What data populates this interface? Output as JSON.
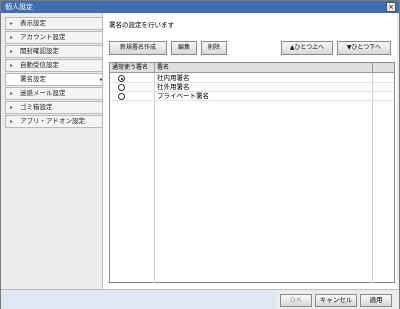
{
  "window": {
    "title": "個人設定",
    "close_label": "×"
  },
  "sidebar": {
    "items": [
      {
        "label": "表示設定"
      },
      {
        "label": "アカウント設定"
      },
      {
        "label": "開封確認設定"
      },
      {
        "label": "自動受信設定"
      },
      {
        "label": "署名設定",
        "active": true
      },
      {
        "label": "迷惑メール設定"
      },
      {
        "label": "ゴミ箱設定"
      },
      {
        "label": "アプリ・アドオン設定"
      }
    ]
  },
  "main": {
    "description": "署名の設定を行います",
    "toolbar": {
      "new_label": "新規署名作成",
      "edit_label": "編集",
      "delete_label": "削除",
      "up_label": "▲ひとつ上へ",
      "down_label": "▼ひとつ下へ"
    },
    "table": {
      "headers": [
        "通常使う署名",
        "署名"
      ],
      "rows": [
        {
          "name": "社内用署名",
          "default": true
        },
        {
          "name": "社外用署名",
          "default": false
        },
        {
          "name": "プライベート署名",
          "default": false
        }
      ]
    }
  },
  "footer": {
    "ok_label": "ＯＫ",
    "cancel_label": "キャンセル",
    "apply_label": "適用"
  }
}
